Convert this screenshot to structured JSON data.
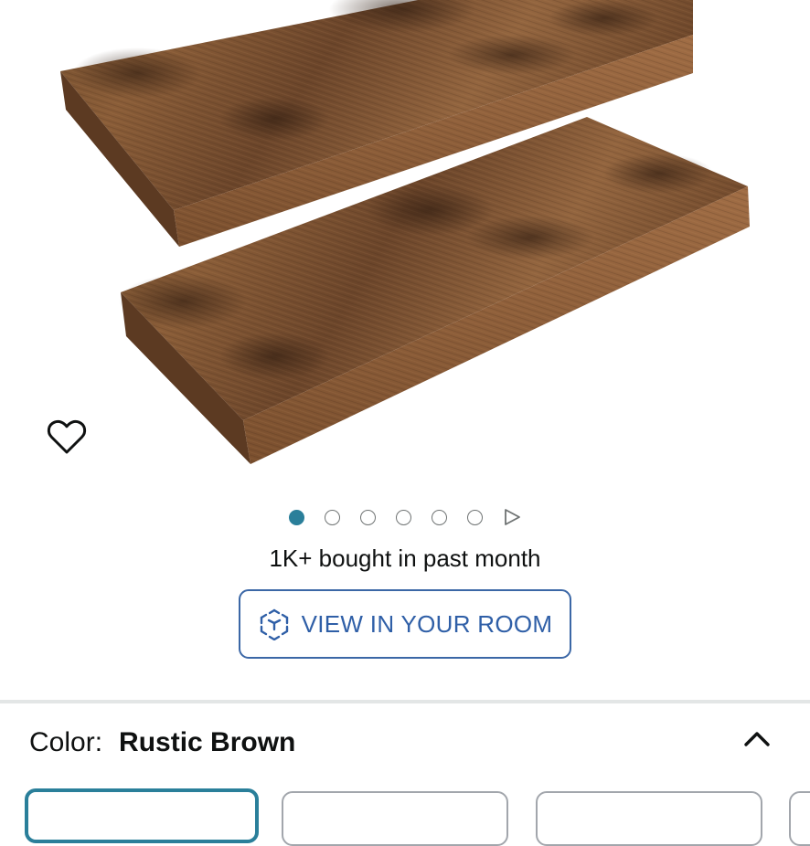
{
  "product": {
    "image_alt": "Rustic brown floating wall shelves, set of 2"
  },
  "carousel": {
    "total_dots": 6,
    "active_index": 0
  },
  "social_proof": {
    "bought_text": "1K+ bought in past month"
  },
  "ar_button": {
    "label": "VIEW IN YOUR ROOM"
  },
  "variation": {
    "key_label": "Color:",
    "selected_value": "Rustic Brown"
  },
  "colors": {
    "accent_teal": "#2a7f9a",
    "link_blue": "#2f5fa7",
    "wood_dark": "#5a3a22",
    "wood_light": "#9b6a42"
  },
  "icons": {
    "wishlist": "heart-outline-icon",
    "ar": "cube-ar-icon",
    "next": "play-triangle-icon",
    "collapse": "chevron-up-icon"
  }
}
